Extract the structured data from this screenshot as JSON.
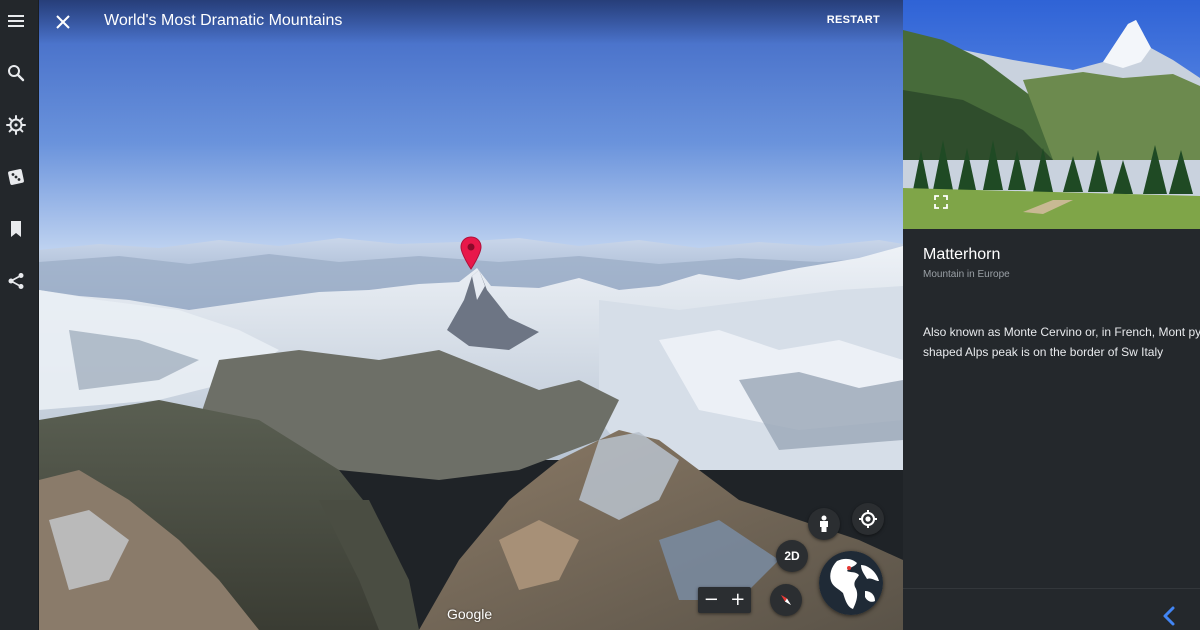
{
  "rail": {
    "items": [
      {
        "name": "menu-icon",
        "label": "Menu"
      },
      {
        "name": "search-icon",
        "label": "Search"
      },
      {
        "name": "voyager-icon",
        "label": "Voyager"
      },
      {
        "name": "dice-icon",
        "label": "I'm Feeling Lucky"
      },
      {
        "name": "bookmark-icon",
        "label": "Projects"
      },
      {
        "name": "share-icon",
        "label": "Share"
      }
    ]
  },
  "header": {
    "title": "World's Most Dramatic Mountains",
    "restart_label": "RESTART"
  },
  "map": {
    "attribution": "Google",
    "btn_2d_label": "2D",
    "zoom_out_label": "−",
    "zoom_in_label": "+"
  },
  "place": {
    "title": "Matterhorn",
    "subtitle": "Mountain in Europe",
    "description": "Also known as Monte Cervino or, in French, Mont pyramid-shaped Alps peak is on the border of Sw Italy"
  },
  "colors": {
    "accent": "#4285f4",
    "pin": "#e8184a",
    "panel": "#24282c",
    "rail": "#23272b"
  }
}
